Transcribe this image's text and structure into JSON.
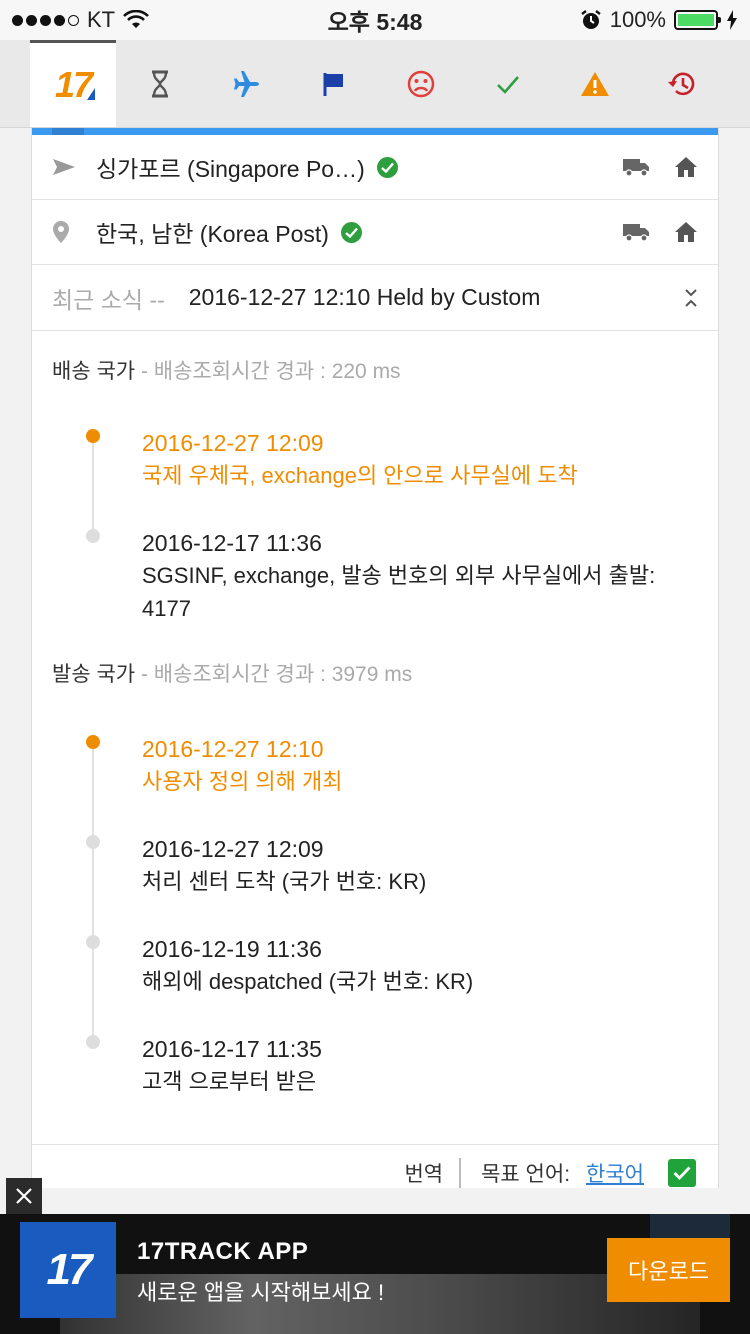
{
  "status_bar": {
    "carrier": "KT",
    "time": "오후 5:48",
    "battery": "100%"
  },
  "tabs": [
    {
      "name": "all",
      "icon": "17track-logo",
      "label": "17"
    },
    {
      "name": "pending",
      "icon": "hourglass-icon"
    },
    {
      "name": "in-transit",
      "icon": "airplane-icon"
    },
    {
      "name": "pickup",
      "icon": "flag-icon"
    },
    {
      "name": "undelivered",
      "icon": "sad-face-icon"
    },
    {
      "name": "delivered",
      "icon": "check-icon"
    },
    {
      "name": "alert",
      "icon": "warning-icon"
    },
    {
      "name": "expired",
      "icon": "history-icon"
    }
  ],
  "carriers": [
    {
      "name": "싱가포르 (Singapore Po…)",
      "icon": "send-icon"
    },
    {
      "name": "한국, 남한 (Korea Post)",
      "icon": "location-pin-icon"
    }
  ],
  "latest": {
    "label": "최근 소식 --",
    "text": "2016-12-27 12:10 Held by Custom"
  },
  "destination": {
    "title": "배송 국가",
    "meta": "- 배송조회시간 경과 : 220 ms",
    "events": [
      {
        "time": "2016-12-27 12:09",
        "desc": "국제 우체국, exchange의 안으로 사무실에 도착"
      },
      {
        "time": "2016-12-17 11:36",
        "desc": "SGSINF, exchange, 발송 번호의 외부 사무실에서 출발: 4177"
      }
    ]
  },
  "origin": {
    "title": "발송 국가",
    "meta": "- 배송조회시간 경과 : 3979 ms",
    "events": [
      {
        "time": "2016-12-27 12:10",
        "desc": "사용자 정의 의해 개최"
      },
      {
        "time": "2016-12-27 12:09",
        "desc": "처리 센터 도착 (국가 번호: KR)"
      },
      {
        "time": "2016-12-19 11:36",
        "desc": "해외에 despatched (국가 번호: KR)"
      },
      {
        "time": "2016-12-17 11:35",
        "desc": "고객 으로부터 받은"
      }
    ]
  },
  "translate": {
    "label": "번역",
    "target_label": "목표 언어:",
    "language": "한국어"
  },
  "ad": {
    "logo": "17",
    "title": "17TRACK APP",
    "subtitle": "새로운 앱을 시작해보세요 !",
    "button": "다운로드"
  },
  "colors": {
    "accent": "#f08c00",
    "blue": "#3a9af0",
    "green": "#2e9e3e"
  }
}
